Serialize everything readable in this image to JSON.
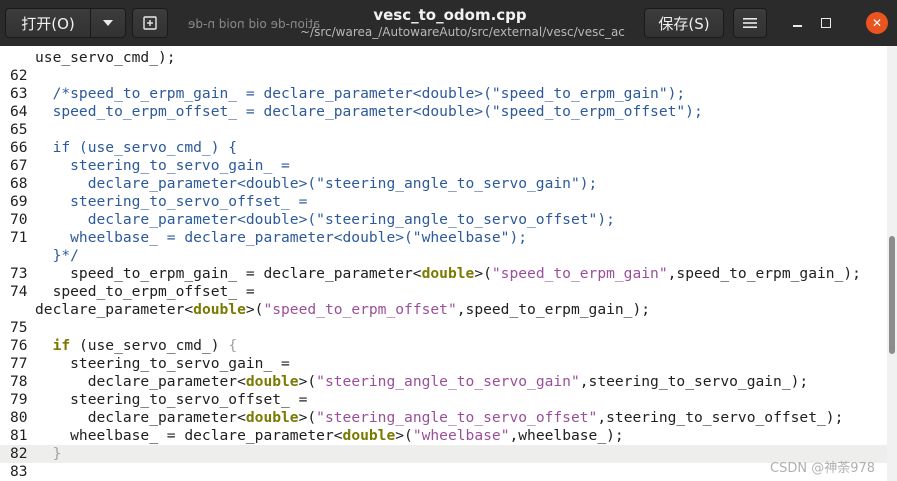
{
  "header": {
    "open_label": "打开(O)",
    "save_label": "保存(S)",
    "title": "vesc_to_odom.cpp",
    "path": "~/src/warea_/AutowareAuto/src/external/vesc/vesc_ack...",
    "ghost_text": "ation-de  oid  noid  n-de"
  },
  "editor": {
    "lines": [
      {
        "num": "",
        "segs": [
          {
            "t": "use_servo_cmd_);"
          }
        ]
      },
      {
        "num": "62",
        "segs": []
      },
      {
        "num": "63",
        "segs": [
          {
            "t": "  /*speed_to_erpm_gain_ = declare_parameter<double>(\"speed_to_erpm_gain\");",
            "c": "cm"
          }
        ]
      },
      {
        "num": "64",
        "segs": [
          {
            "t": "  speed_to_erpm_offset_ = declare_parameter<double>(\"speed_to_erpm_offset\");",
            "c": "cm"
          }
        ]
      },
      {
        "num": "65",
        "segs": []
      },
      {
        "num": "66",
        "segs": [
          {
            "t": "  if (use_servo_cmd_) {",
            "c": "cm"
          }
        ]
      },
      {
        "num": "67",
        "segs": [
          {
            "t": "    steering_to_servo_gain_ =",
            "c": "cm"
          }
        ]
      },
      {
        "num": "68",
        "segs": [
          {
            "t": "      declare_parameter<double>(\"steering_angle_to_servo_gain\");",
            "c": "cm"
          }
        ]
      },
      {
        "num": "69",
        "segs": [
          {
            "t": "    steering_to_servo_offset_ =",
            "c": "cm"
          }
        ]
      },
      {
        "num": "70",
        "segs": [
          {
            "t": "      declare_parameter<double>(\"steering_angle_to_servo_offset\");",
            "c": "cm"
          }
        ]
      },
      {
        "num": "71",
        "segs": [
          {
            "t": "    wheelbase_ = declare_parameter<double>(\"wheelbase\");",
            "c": "cm"
          }
        ]
      },
      {
        "num": "",
        "segs": [
          {
            "t": "  }*/",
            "c": "cm"
          }
        ]
      },
      {
        "num": "73",
        "segs": [
          {
            "t": "    speed_to_erpm_gain_ = declare_parameter<"
          },
          {
            "t": "double",
            "c": "kw"
          },
          {
            "t": ">("
          },
          {
            "t": "\"speed_to_erpm_gain\"",
            "c": "st"
          },
          {
            "t": ",speed_to_erpm_gain_);"
          }
        ]
      },
      {
        "num": "74",
        "segs": [
          {
            "t": "  speed_to_erpm_offset_ ="
          }
        ]
      },
      {
        "num": "",
        "segs": [
          {
            "t": "declare_parameter<"
          },
          {
            "t": "double",
            "c": "kw"
          },
          {
            "t": ">("
          },
          {
            "t": "\"speed_to_erpm_offset\"",
            "c": "st"
          },
          {
            "t": ",speed_to_erpm_gain_);"
          }
        ]
      },
      {
        "num": "75",
        "segs": []
      },
      {
        "num": "76",
        "segs": [
          {
            "t": "  "
          },
          {
            "t": "if",
            "c": "kw"
          },
          {
            "t": " (use_servo_cmd_) "
          },
          {
            "t": "{",
            "c": "ma"
          }
        ]
      },
      {
        "num": "77",
        "segs": [
          {
            "t": "    steering_to_servo_gain_ ="
          }
        ]
      },
      {
        "num": "78",
        "segs": [
          {
            "t": "      declare_parameter<"
          },
          {
            "t": "double",
            "c": "kw"
          },
          {
            "t": ">("
          },
          {
            "t": "\"steering_angle_to_servo_gain\"",
            "c": "st"
          },
          {
            "t": ",steering_to_servo_gain_);"
          }
        ]
      },
      {
        "num": "79",
        "segs": [
          {
            "t": "    steering_to_servo_offset_ ="
          }
        ]
      },
      {
        "num": "80",
        "segs": [
          {
            "t": "      declare_parameter<"
          },
          {
            "t": "double",
            "c": "kw"
          },
          {
            "t": ">("
          },
          {
            "t": "\"steering_angle_to_servo_offset\"",
            "c": "st"
          },
          {
            "t": ",steering_to_servo_offset_);"
          }
        ]
      },
      {
        "num": "81",
        "segs": [
          {
            "t": "    wheelbase_ = declare_parameter<"
          },
          {
            "t": "double",
            "c": "kw"
          },
          {
            "t": ">("
          },
          {
            "t": "\"wheelbase\"",
            "c": "st"
          },
          {
            "t": ",wheelbase_);"
          }
        ]
      },
      {
        "num": "82",
        "current": true,
        "segs": [
          {
            "t": "  "
          },
          {
            "t": "}",
            "c": "ma"
          }
        ]
      },
      {
        "num": "83",
        "segs": []
      }
    ]
  },
  "scroll_position": 0.6,
  "watermark": "CSDN @神荼978",
  "colors": {
    "titlebar": "#2b2b2b",
    "close_button": "#e95420",
    "comment": "#2d5a9a",
    "keyword": "#7a7a00",
    "string": "#9a4f9a",
    "current_line": "#eeeeec"
  },
  "icons": {
    "dropdown": "chevron-down-icon",
    "new_tab": "new-tab-icon",
    "menu": "hamburger-menu-icon",
    "minimize": "minimize-icon",
    "maximize": "maximize-icon",
    "close": "close-icon"
  }
}
